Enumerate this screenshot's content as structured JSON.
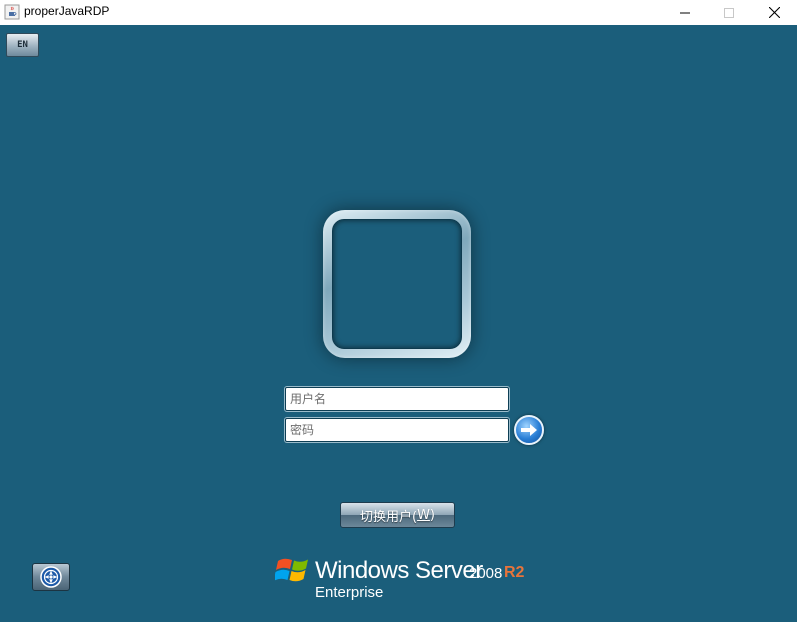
{
  "window": {
    "title": "properJavaRDP"
  },
  "language_button": {
    "label": "EN"
  },
  "login": {
    "username_placeholder": "用户名",
    "password_placeholder": "密码",
    "switch_user_label": "切换用户(",
    "switch_user_accel": "W",
    "switch_user_close": ")"
  },
  "brand": {
    "name": "Windows Server",
    "version": "2008",
    "release": "R2",
    "edition": "Enterprise"
  },
  "icons": {
    "app": "java-cup-icon",
    "submit": "arrow-right-icon",
    "ease_of_access": "ease-of-access-icon",
    "logo": "windows-flag-icon"
  },
  "colors": {
    "desktop_background": "#1b5e7b",
    "release_accent": "#e8743b"
  }
}
